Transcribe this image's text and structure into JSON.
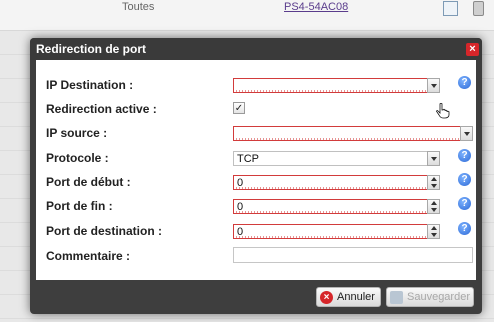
{
  "background": {
    "row_audience": "Toutes",
    "row_link": "PS4-54AC08"
  },
  "dialog": {
    "title": "Redirection de port",
    "close_glyph": "×",
    "help_glyph": "?",
    "fields": {
      "ip_destination": {
        "label": "IP Destination :",
        "value": ""
      },
      "redirection_active": {
        "label": "Redirection active :",
        "checked": true,
        "check_glyph": "✓"
      },
      "ip_source": {
        "label": "IP source :",
        "value": ""
      },
      "protocole": {
        "label": "Protocole :",
        "value": "TCP"
      },
      "port_debut": {
        "label": "Port de début :",
        "value": "0"
      },
      "port_fin": {
        "label": "Port de fin :",
        "value": "0"
      },
      "port_destination": {
        "label": "Port de destination :",
        "value": "0"
      },
      "commentaire": {
        "label": "Commentaire :",
        "value": ""
      }
    },
    "buttons": {
      "cancel": "Annuler",
      "save": "Sauvegarder"
    }
  },
  "colors": {
    "dialog_frame": "#3e3e3e",
    "invalid_border": "#d23b3b",
    "close_red": "#d6262a",
    "help_blue": "#2c69d6"
  },
  "icons": {
    "close": "close-icon",
    "help": "help-icon",
    "cancel": "cancel-icon",
    "save": "save-icon",
    "edit": "edit-icon",
    "delete": "trash-icon",
    "pointer": "hand-pointer-icon"
  }
}
